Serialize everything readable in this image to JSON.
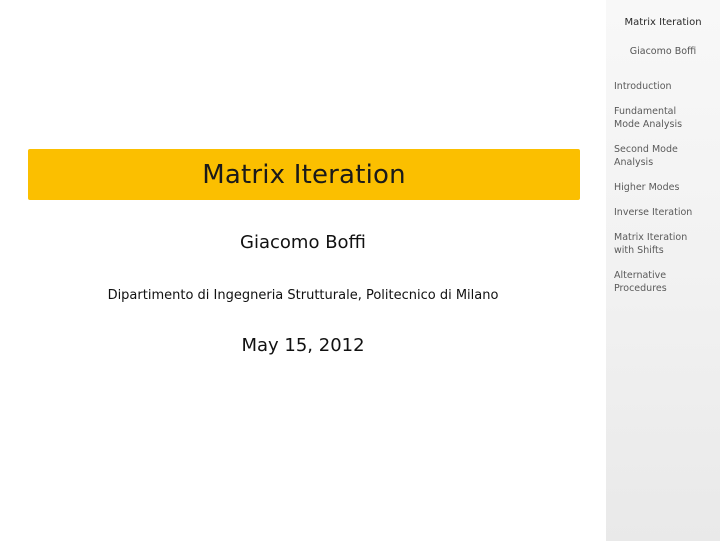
{
  "slide": {
    "title": "Matrix Iteration",
    "author": "Giacomo Boffi",
    "affiliation": "Dipartimento di Ingegneria Strutturale, Politecnico di Milano",
    "date": "May 15, 2012"
  },
  "sidebar": {
    "title": "Matrix Iteration",
    "author": "Giacomo Boffi",
    "items": [
      {
        "label_line1": "Introduction",
        "label_line2": ""
      },
      {
        "label_line1": "Fundamental",
        "label_line2": "Mode Analysis"
      },
      {
        "label_line1": "Second Mode",
        "label_line2": "Analysis"
      },
      {
        "label_line1": "Higher Modes",
        "label_line2": ""
      },
      {
        "label_line1": "Inverse Iteration",
        "label_line2": ""
      },
      {
        "label_line1": "Matrix Iteration",
        "label_line2": "with Shifts"
      },
      {
        "label_line1": "Alternative",
        "label_line2": "Procedures"
      }
    ]
  },
  "colors": {
    "title_bar": "#fbbf00",
    "sidebar_bg": "#f1f1f1"
  }
}
